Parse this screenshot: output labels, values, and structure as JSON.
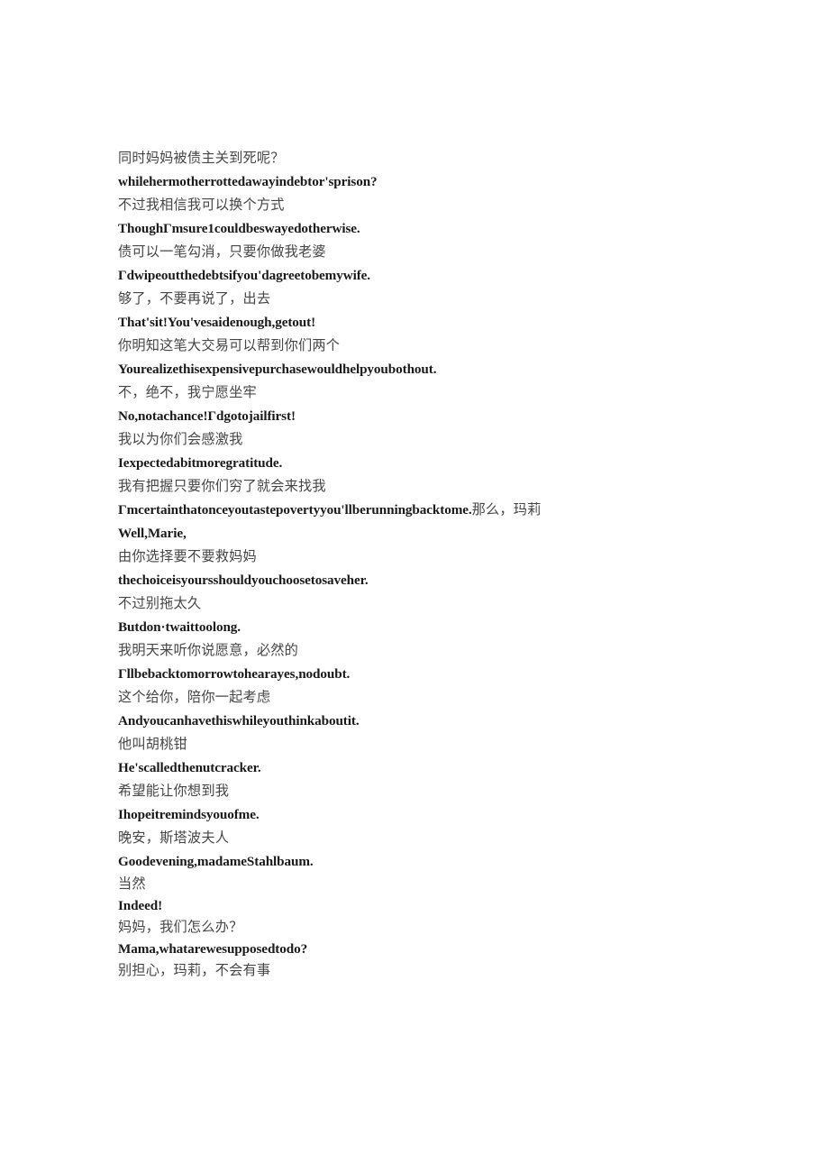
{
  "document": {
    "type": "bilingual-subtitle-transcript",
    "background_color": "#ffffff",
    "source_language_color": "#464646",
    "target_language_color": "#1a1a1a"
  },
  "lines": {
    "l01_zh": "同时妈妈被债主关到死呢？",
    "l01_en": "whilehermotherrottedawayindebtor'sprison?",
    "l02_zh": "不过我相信我可以换个方式",
    "l02_en": "ThoughГmsure1couldbeswayedotherwise.",
    "l03_zh": "债可以一笔勾消，只要你做我老婆",
    "l03_en": "Гdwipeoutthedebtsifyou'dagreetobemywife.",
    "l04_zh": "够了，不要再说了，出去",
    "l04_en": "That'sit!You'vesaidenough,getout!",
    "l05_zh": "你明知这笔大交易可以帮到你们两个",
    "l05_en": "Yourealizethisexpensivepurchasewouldhelpyoubothout.",
    "l06_zh": "不，绝不，我宁愿坐牢",
    "l06_en": "No,notachance!Гdgotojailfirst!",
    "l07_zh": "我以为你们会感激我",
    "l07_en": "Iexpectedabitmoregratitude.",
    "l08_zh": "我有把握只要你们穷了就会来找我",
    "l08_en_part": "Гmcertainthatonceyoutastepovertyyou'llberunningbacktome.",
    "l08_zh_tail": "那么，玛莉",
    "l09_en": "Well,Marie,",
    "l10_zh": "由你选择要不要救妈妈",
    "l10_en": "thechoiceisyoursshouldyouchoosetosaveher.",
    "l11_zh": "不过别拖太久",
    "l11_en": "Butdon·twaittoolong.",
    "l12_zh": "我明天来听你说愿意，必然的",
    "l12_en": "Гllbebacktomorrowtohearayes,nodoubt.",
    "l13_zh": "这个给你，陪你一起考虑",
    "l13_en": "Andyoucanhavethiswhileyouthinkaboutit.",
    "l14_zh": "他叫胡桃钳",
    "l14_en": "He'scalledthenutcracker.",
    "l15_zh": "希望能让你想到我",
    "l15_en": "Ihopeitremindsyouofme.",
    "l16_zh": "晚安，斯塔波夫人",
    "l16_en": "Goodevening,madameStahlbaum.",
    "l17_zh": "当然",
    "l17_en": "Indeed!",
    "l18_zh": "妈妈，我们怎么办？",
    "l18_en": "Mama,whatarewesupposedtodo?",
    "l19_zh": "别担心，玛莉，不会有事"
  }
}
